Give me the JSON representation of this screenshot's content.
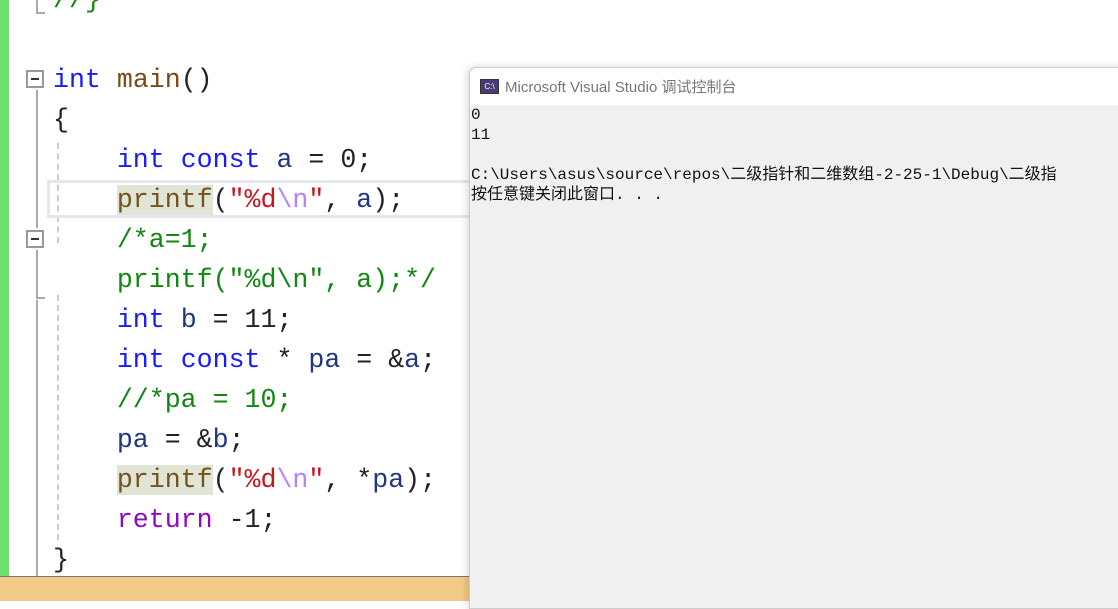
{
  "editor": {
    "lines": [
      [
        {
          "t": "//}",
          "c": "cm"
        }
      ],
      [],
      [
        {
          "t": "int",
          "c": "kw"
        },
        {
          "t": " ",
          "c": "pl"
        },
        {
          "t": "main",
          "c": "id"
        },
        {
          "t": "()",
          "c": "pl"
        }
      ],
      [
        {
          "t": "{",
          "c": "pl"
        }
      ],
      [
        {
          "t": "    ",
          "c": "pl"
        },
        {
          "t": "int",
          "c": "kw"
        },
        {
          "t": " ",
          "c": "pl"
        },
        {
          "t": "const",
          "c": "kw"
        },
        {
          "t": " ",
          "c": "pl"
        },
        {
          "t": "a",
          "c": "var"
        },
        {
          "t": " = 0;",
          "c": "pl"
        }
      ],
      [
        {
          "t": "    ",
          "c": "pl"
        },
        {
          "t": "printf",
          "c": "fn hl"
        },
        {
          "t": "(",
          "c": "pl"
        },
        {
          "t": "\"%d",
          "c": "str"
        },
        {
          "t": "\\n",
          "c": "esc"
        },
        {
          "t": "\"",
          "c": "str"
        },
        {
          "t": ", ",
          "c": "pl"
        },
        {
          "t": "a",
          "c": "var"
        },
        {
          "t": ");",
          "c": "pl"
        }
      ],
      [
        {
          "t": "    /*a=1;",
          "c": "cm"
        }
      ],
      [
        {
          "t": "    printf(\"%d\\n\", a);*/",
          "c": "cm"
        }
      ],
      [
        {
          "t": "    ",
          "c": "pl"
        },
        {
          "t": "int",
          "c": "kw"
        },
        {
          "t": " ",
          "c": "pl"
        },
        {
          "t": "b",
          "c": "var"
        },
        {
          "t": " = 11;",
          "c": "pl"
        }
      ],
      [
        {
          "t": "    ",
          "c": "pl"
        },
        {
          "t": "int",
          "c": "kw"
        },
        {
          "t": " ",
          "c": "pl"
        },
        {
          "t": "const",
          "c": "kw"
        },
        {
          "t": " * ",
          "c": "pl"
        },
        {
          "t": "pa",
          "c": "var"
        },
        {
          "t": " = &",
          "c": "pl"
        },
        {
          "t": "a",
          "c": "var"
        },
        {
          "t": ";",
          "c": "pl"
        }
      ],
      [
        {
          "t": "    //*pa = 10;",
          "c": "cm"
        }
      ],
      [
        {
          "t": "    ",
          "c": "pl"
        },
        {
          "t": "pa",
          "c": "var"
        },
        {
          "t": " = &",
          "c": "pl"
        },
        {
          "t": "b",
          "c": "var"
        },
        {
          "t": ";",
          "c": "pl"
        }
      ],
      [
        {
          "t": "    ",
          "c": "pl"
        },
        {
          "t": "printf",
          "c": "fn hl"
        },
        {
          "t": "(",
          "c": "pl"
        },
        {
          "t": "\"%d",
          "c": "str"
        },
        {
          "t": "\\n",
          "c": "esc"
        },
        {
          "t": "\"",
          "c": "str"
        },
        {
          "t": ", *",
          "c": "pl"
        },
        {
          "t": "pa",
          "c": "var"
        },
        {
          "t": ");",
          "c": "pl"
        }
      ],
      [
        {
          "t": "    ",
          "c": "pl"
        },
        {
          "t": "return",
          "c": "ret"
        },
        {
          "t": " -1;",
          "c": "pl"
        }
      ],
      [
        {
          "t": "}",
          "c": "pl"
        }
      ]
    ]
  },
  "console": {
    "app_icon": "C:\\",
    "title": "Microsoft Visual Studio 调试控制台",
    "output": [
      "0",
      "11",
      "",
      "C:\\Users\\asus\\source\\repos\\二级指针和二维数组-2-25-1\\Debug\\二级指",
      "按任意键关闭此窗口. . ."
    ]
  }
}
